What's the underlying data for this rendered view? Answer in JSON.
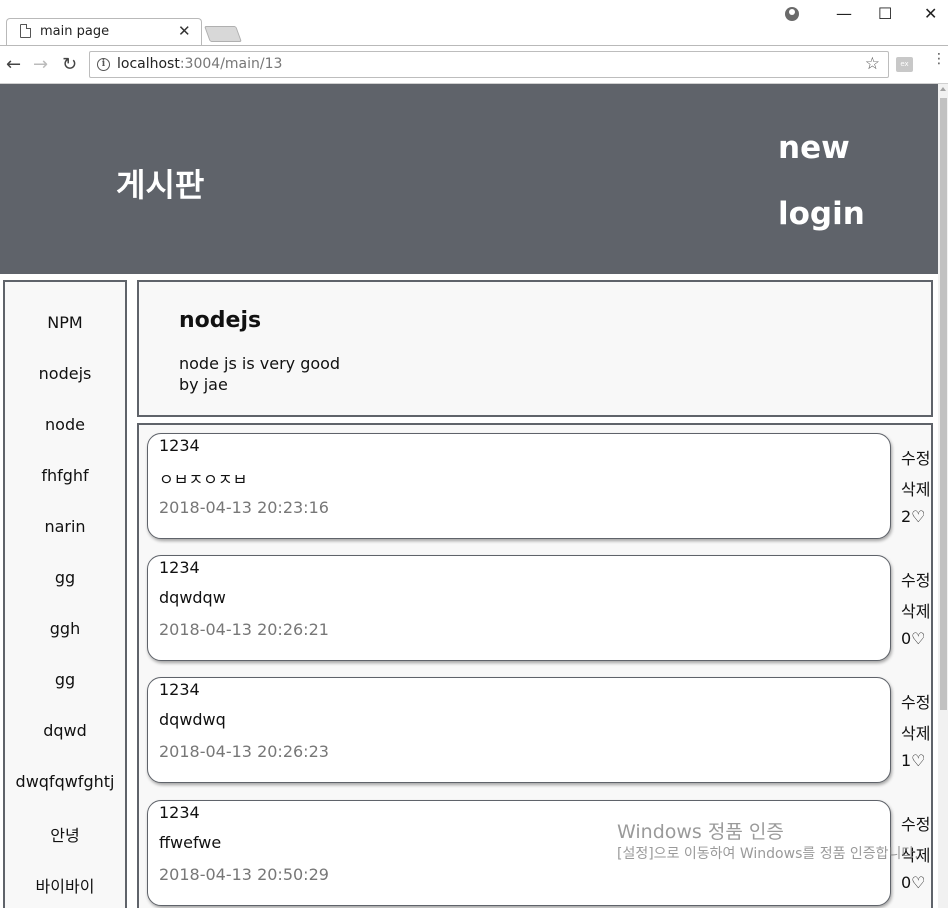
{
  "browser": {
    "tab_title": "main page",
    "tab_close": "✕",
    "url_host": "localhost",
    "url_rest": ":3004/main/13",
    "controls": {
      "minimize": "—",
      "maximize": "☐",
      "close": "✕"
    },
    "nav": {
      "back": "←",
      "forward": "→",
      "reload": "↻"
    },
    "star": "☆",
    "ext_label": "ex",
    "menu": "⋮"
  },
  "header": {
    "title": "게시판",
    "links": [
      {
        "label": "new"
      },
      {
        "label": "login"
      }
    ]
  },
  "sidebar": {
    "items": [
      {
        "label": "NPM"
      },
      {
        "label": "nodejs"
      },
      {
        "label": "node"
      },
      {
        "label": "fhfghf"
      },
      {
        "label": "narin"
      },
      {
        "label": "gg"
      },
      {
        "label": "ggh"
      },
      {
        "label": "gg"
      },
      {
        "label": "dqwd"
      },
      {
        "label": "dwqfqwfghtj"
      },
      {
        "label": "안녕"
      },
      {
        "label": "바이바이"
      }
    ]
  },
  "post": {
    "title": "nodejs",
    "body": "node js is very good",
    "author": "by jae"
  },
  "comments": [
    {
      "author": "1234",
      "text": "ㅇㅂㅈㅇㅈㅂ",
      "date": "2018-04-13 20:23:16",
      "edit": "수정",
      "delete": "삭제",
      "likes": "2♡"
    },
    {
      "author": "1234",
      "text": "dqwdqw",
      "date": "2018-04-13 20:26:21",
      "edit": "수정",
      "delete": "삭제",
      "likes": "0♡"
    },
    {
      "author": "1234",
      "text": "dqwdwq",
      "date": "2018-04-13 20:26:23",
      "edit": "수정",
      "delete": "삭제",
      "likes": "1♡"
    },
    {
      "author": "1234",
      "text": "ffwefwe",
      "date": "2018-04-13 20:50:29",
      "edit": "수정",
      "delete": "삭제",
      "likes": "0♡"
    }
  ],
  "watermark": {
    "line1": "Windows 정품 인증",
    "line2": "[설정]으로 이동하여 Windows를 정품 인증합니다."
  },
  "colors": {
    "header_bg": "#5f636a",
    "panel_bg": "#f8f8f8",
    "date_text": "#777777"
  }
}
